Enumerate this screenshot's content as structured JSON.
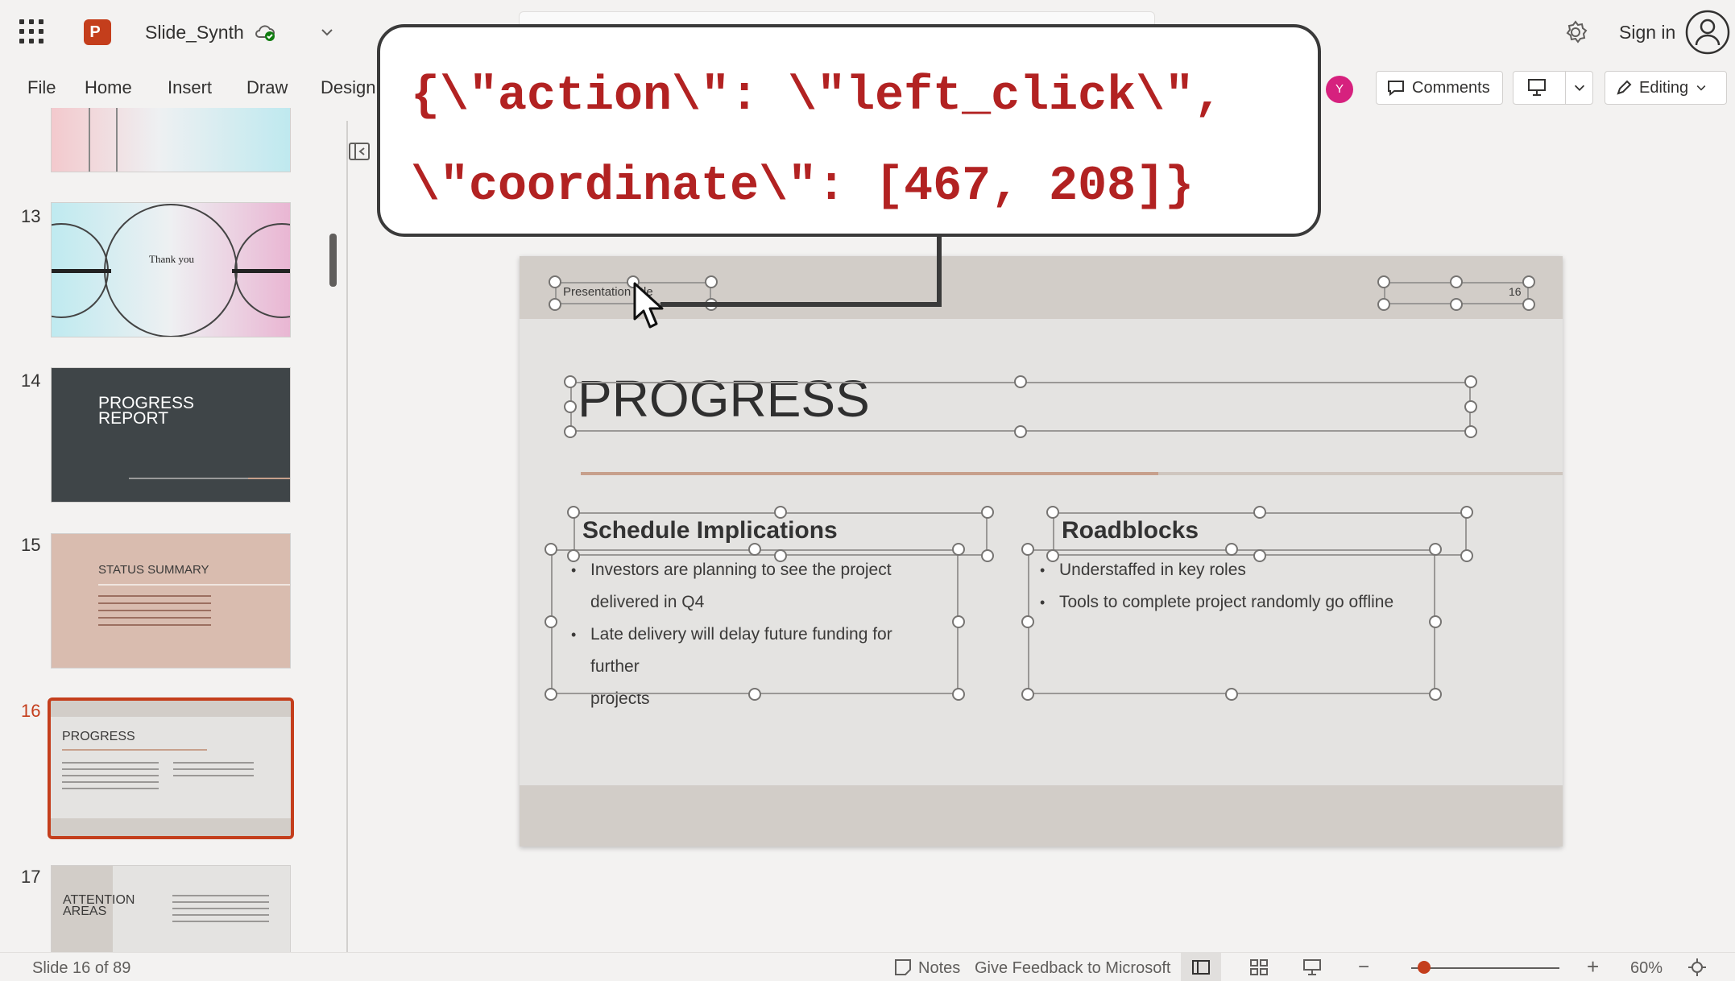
{
  "app": {
    "doc_title": "Slide_Synth",
    "sign_in": "Sign in",
    "avatar_initial": "Y",
    "comments_label": "Comments",
    "editing_label": "Editing"
  },
  "ribbon": {
    "tabs": [
      "File",
      "Home",
      "Insert",
      "Draw",
      "Design"
    ]
  },
  "thumbnails": [
    {
      "number": "13",
      "title": "Thank you"
    },
    {
      "number": "14",
      "title": "PROGRESS REPORT"
    },
    {
      "number": "15",
      "title": "STATUS SUMMARY"
    },
    {
      "number": "16",
      "title": "PROGRESS"
    },
    {
      "number": "17",
      "title": "ATTENTION AREAS"
    }
  ],
  "slide": {
    "footer": "Presentation title",
    "slide_number": "16",
    "heading": "PROGRESS",
    "left_subheading": "Schedule Implications",
    "left_bullets": [
      "Investors are planning to see the project",
      "delivered in Q4",
      "Late delivery will delay future funding for further",
      "projects"
    ],
    "right_subheading": "Roadblocks",
    "right_bullets": [
      "Understaffed in key roles",
      "Tools to complete project randomly go offline"
    ]
  },
  "status": {
    "slide_counter": "Slide 16 of 89",
    "notes": "Notes",
    "feedback": "Give Feedback to Microsoft",
    "zoom_minus": "−",
    "zoom_plus": "+",
    "zoom_value": "60%",
    "zoom_level": 0.6
  },
  "action": {
    "line1": "{\\\"action\\\": \\\"left_click\\\",",
    "line2": "\\\"coordinate\\\": [467, 208]}"
  },
  "colors": {
    "accent": "#c43e1c",
    "callout_text": "#b22222",
    "avatar": "#d6217e"
  }
}
